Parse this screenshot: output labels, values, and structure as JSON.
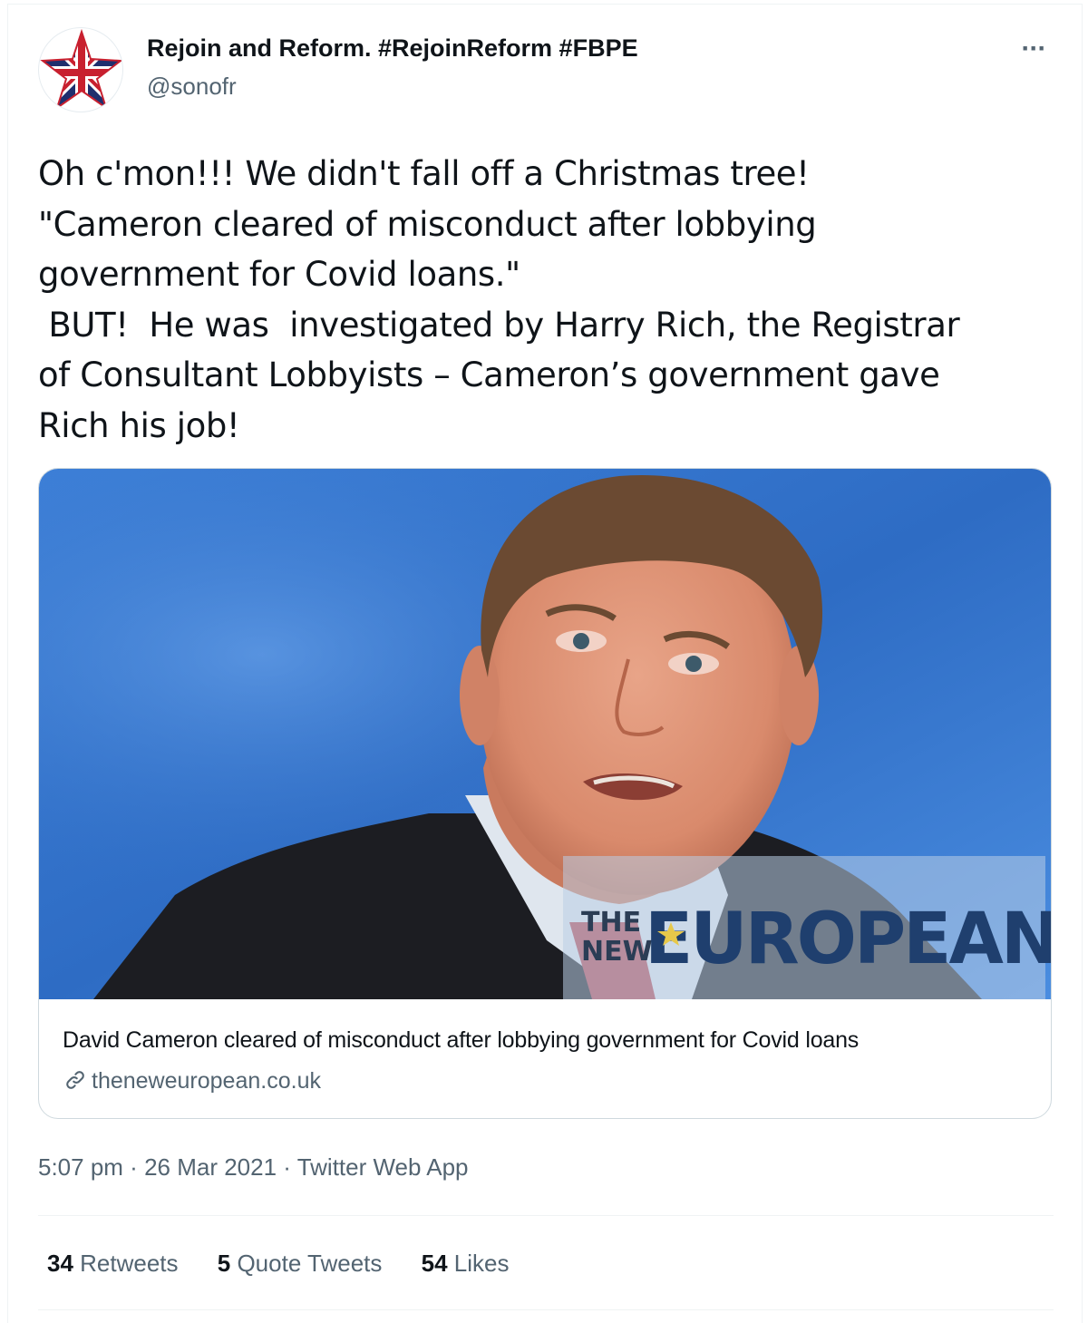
{
  "author": {
    "display_name": "Rejoin and Reform. #RejoinReform #FBPE",
    "handle": "@sonofr"
  },
  "more_label": "···",
  "tweet": {
    "lines": [
      "Oh c'mon!!! We didn't fall off a Christmas tree!",
      "\"Cameron cleared of misconduct after lobbying",
      "government for Covid loans.\"",
      " BUT!  He was  investigated by Harry Rich, the Registrar",
      "of Consultant Lobbyists – Cameron’s government gave",
      "Rich his job!"
    ]
  },
  "card": {
    "watermark_small_top": "THE",
    "watermark_small_bottom": "NEW",
    "watermark_large": "EUROPEAN",
    "title": "David Cameron cleared of misconduct after lobbying government for Covid loans",
    "domain": "theneweuropean.co.uk",
    "link_icon": "link-icon"
  },
  "meta": {
    "time": "5:07 pm",
    "separator": " · ",
    "date": "26 Mar 2021",
    "source": "Twitter Web App"
  },
  "stats": {
    "retweets_count": "34",
    "retweets_label": " Retweets",
    "quotes_count": "5",
    "quotes_label": " Quote Tweets",
    "likes_count": "54",
    "likes_label": " Likes"
  },
  "colors": {
    "text": "#0f1419",
    "secondary": "#536471",
    "border": "#cfd9de",
    "photo_background": "#3a7ad6"
  }
}
